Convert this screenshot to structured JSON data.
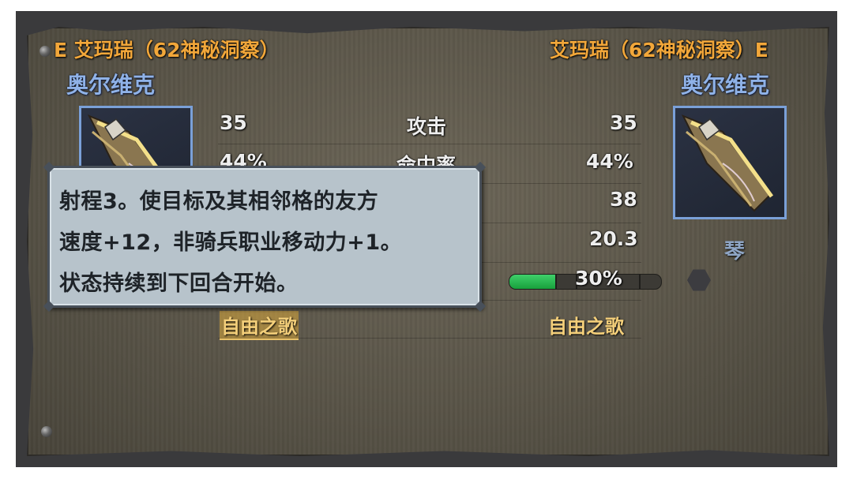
{
  "left_unit": {
    "title": "E 艾玛瑞（62神秘洞察）",
    "name": "奥尔维克",
    "skill": "自由之歌"
  },
  "right_unit": {
    "title": "艾玛瑞（62神秘洞察）E",
    "name": "奥尔维克",
    "skill": "自由之歌",
    "weapon_type": "琴"
  },
  "stats": [
    {
      "label": "攻击",
      "left": "35",
      "right": "35"
    },
    {
      "label": "命中率",
      "left": "44%",
      "right": "44%"
    },
    {
      "label": "",
      "left": "",
      "right": "38"
    },
    {
      "label": "",
      "left": "",
      "right": "20.3"
    }
  ],
  "progress": {
    "text": "30%",
    "value": 0.3
  },
  "tooltip": {
    "lines": [
      "射程3。使目标及其相邻格的友方",
      "速度+12，非骑兵职业移动力+1。",
      "状态持续到下回合开始。"
    ]
  },
  "colors": {
    "title": "#f2a73a",
    "name": "#8fb2e8",
    "tooltip_bg": "#b7c3cb",
    "bar_fill": "#2bbb50"
  },
  "icons": {
    "portrait_left": "harp-weapon-icon",
    "portrait_right": "harp-weapon-icon",
    "hex": "hexagon-icon",
    "rivet": "rivet-icon"
  }
}
